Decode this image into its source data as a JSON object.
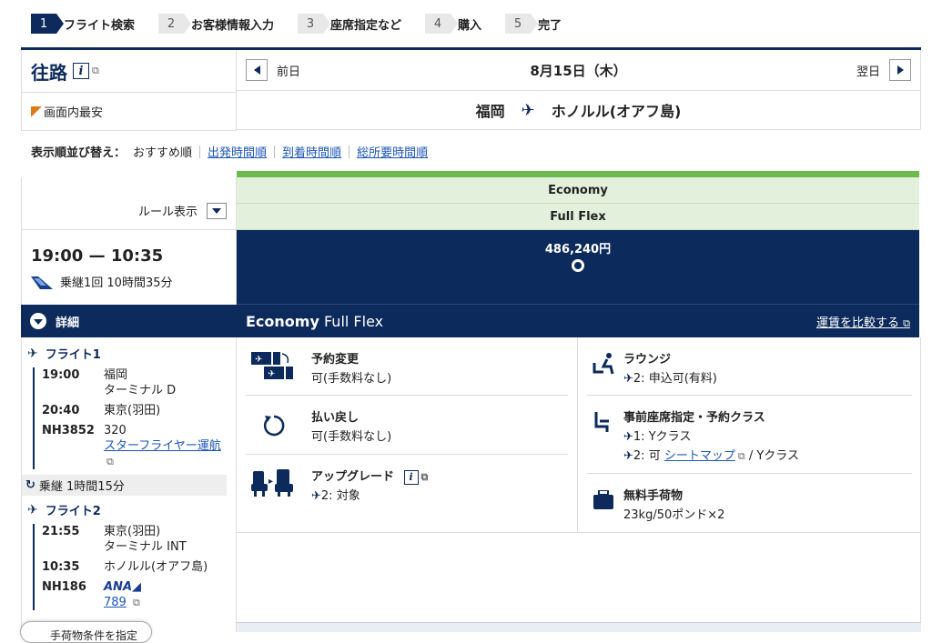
{
  "steps": [
    {
      "num": "1",
      "label": "フライト検索"
    },
    {
      "num": "2",
      "label": "お客様情報入力"
    },
    {
      "num": "3",
      "label": "座席指定など"
    },
    {
      "num": "4",
      "label": "購入"
    },
    {
      "num": "5",
      "label": "完了"
    }
  ],
  "left": {
    "title": "往路",
    "cheapest_label": "画面内最安"
  },
  "nav": {
    "prev": "前日",
    "date": "8月15日（木）",
    "next": "翌日"
  },
  "route": {
    "from": "福岡",
    "to": "ホノルル(オアフ島)"
  },
  "sort": {
    "label": "表示順並び替え：",
    "current": "おすすめ順",
    "options": [
      "出発時間順",
      "到着時間順",
      "総所要時間順"
    ]
  },
  "rule_label": "ルール表示",
  "itinerary": {
    "time": "19:00 — 10:35",
    "stops": "乗継1回 10時間35分",
    "detail_label": "詳細",
    "flight1": {
      "title": "フライト1",
      "dep_time": "19:00",
      "dep_place": "福岡",
      "dep_terminal": "ターミナル D",
      "arr_time": "20:40",
      "arr_place": "東京(羽田)",
      "flight_no": "NH3852",
      "aircraft": "320",
      "operator": "スターフライヤー運航"
    },
    "transfer": "乗継 1時間15分",
    "flight2": {
      "title": "フライト2",
      "dep_time": "21:55",
      "dep_place": "東京(羽田)",
      "dep_terminal": "ターミナル INT",
      "arr_time": "10:35",
      "arr_place": "ホノルル(オアフ島)",
      "flight_no": "NH186",
      "airline_logo": "ANA",
      "aircraft": "789"
    },
    "bottom_button": "手荷物条件を指定"
  },
  "fare": {
    "cabin": "Economy",
    "fare_type": "Full Flex",
    "price": "486,240円",
    "title_bold": "Economy",
    "title_rest": " Full Flex",
    "compare": "運賃を比較する"
  },
  "conditions": {
    "change": {
      "head": "予約変更",
      "text": "可(手数料なし)"
    },
    "refund": {
      "head": "払い戻し",
      "text": "可(手数料なし)"
    },
    "upgrade": {
      "head": "アップグレード",
      "text": "2: 対象"
    },
    "lounge": {
      "head": "ラウンジ",
      "text": "2: 申込可(有料)"
    },
    "seat": {
      "head": "事前座席指定・予約クラス",
      "line1": "1: Yクラス",
      "line2_pre": "2: 可 ",
      "seatmap": "シートマップ",
      "line2_post": " / Yクラス"
    },
    "baggage": {
      "head": "無料手荷物",
      "text": "23kg/50ポンド×2"
    }
  },
  "colors": {
    "navy": "#0c2a5b",
    "green": "#6cbb4f",
    "light_green": "#e3f1dc",
    "orange": "#e07a19"
  }
}
